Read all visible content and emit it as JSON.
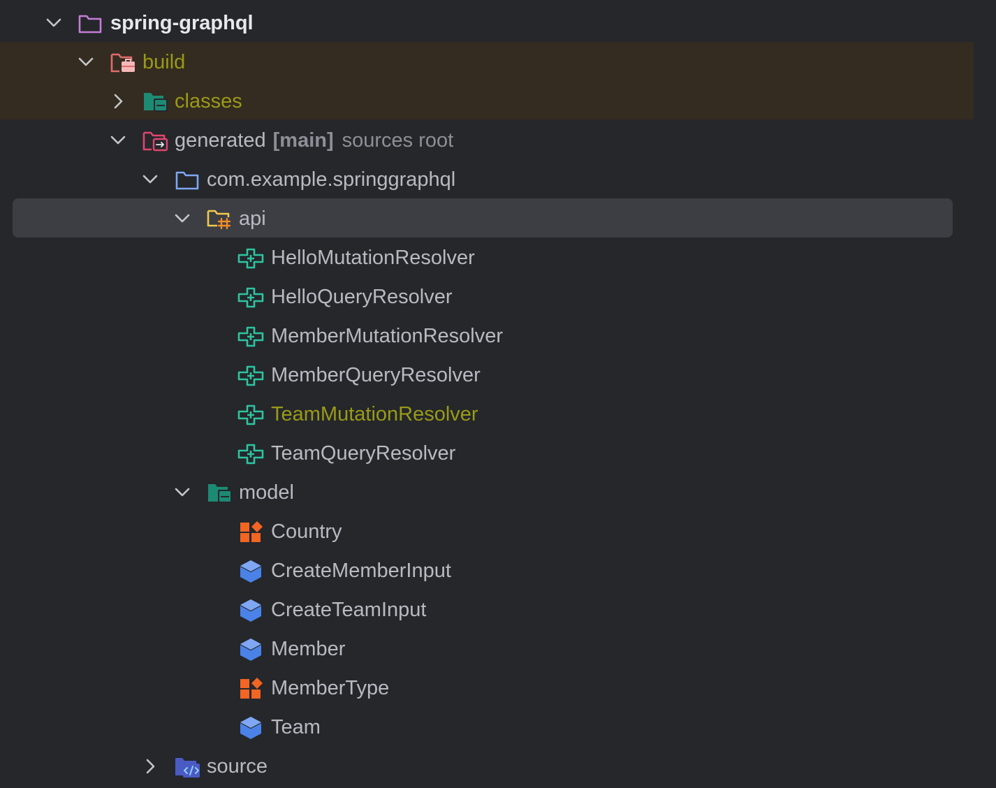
{
  "tree": {
    "root": {
      "label": "spring-graphql",
      "icon": "module-folder-icon",
      "expanded": true
    },
    "build": {
      "label": "build",
      "icon": "excluded-folder-icon",
      "expanded": true
    },
    "classes": {
      "label": "classes",
      "icon": "package-folder-icon",
      "expanded": false
    },
    "generated": {
      "label": "generated",
      "tag": "[main]",
      "hint": "sources root",
      "icon": "generated-sources-root-icon",
      "expanded": true
    },
    "package": {
      "label": "com.example.springgraphql",
      "icon": "folder-icon",
      "expanded": true
    },
    "api": {
      "label": "api",
      "icon": "api-folder-icon",
      "expanded": true,
      "selected": true,
      "items": [
        {
          "label": "HelloMutationResolver",
          "icon": "interface-icon"
        },
        {
          "label": "HelloQueryResolver",
          "icon": "interface-icon"
        },
        {
          "label": "MemberMutationResolver",
          "icon": "interface-icon"
        },
        {
          "label": "MemberQueryResolver",
          "icon": "interface-icon"
        },
        {
          "label": "TeamMutationResolver",
          "icon": "interface-icon",
          "modified": true
        },
        {
          "label": "TeamQueryResolver",
          "icon": "interface-icon"
        }
      ]
    },
    "model": {
      "label": "model",
      "icon": "package-folder-icon",
      "expanded": true,
      "items": [
        {
          "label": "Country",
          "icon": "enum-icon"
        },
        {
          "label": "CreateMemberInput",
          "icon": "class-icon"
        },
        {
          "label": "CreateTeamInput",
          "icon": "class-icon"
        },
        {
          "label": "Member",
          "icon": "class-icon"
        },
        {
          "label": "MemberType",
          "icon": "enum-icon"
        },
        {
          "label": "Team",
          "icon": "class-icon"
        }
      ]
    },
    "source": {
      "label": "source",
      "icon": "source-folder-icon",
      "expanded": false
    }
  },
  "colors": {
    "background": "#25272b",
    "excluded_band": "#342c20",
    "selected_row": "#3c3e43",
    "text": "#b7bbc1",
    "modified_text": "#9a9a16",
    "interface_icon": "#2ec4a0",
    "enum_icon": "#f26522",
    "class_icon": "#4a82e8"
  }
}
